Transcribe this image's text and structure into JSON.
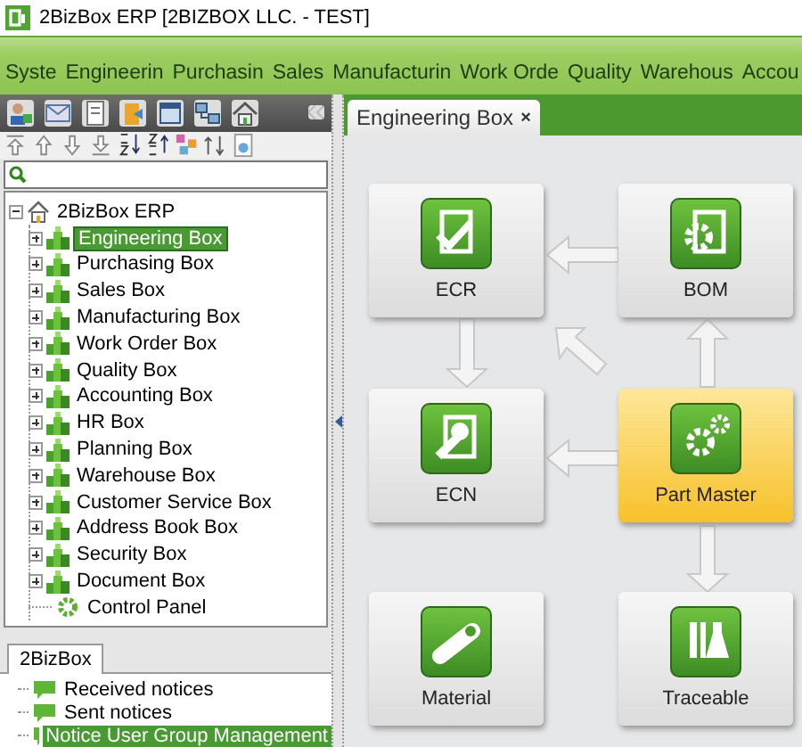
{
  "window": {
    "title": "2BizBox ERP [2BIZBOX LLC. - TEST]"
  },
  "menu": [
    "Syste",
    "Engineerin",
    "Purchasin",
    "Sales",
    "Manufacturin",
    "Work Orde",
    "Quality",
    "Warehous",
    "Accou"
  ],
  "sidebar": {
    "tree": {
      "label": "2BizBox ERP",
      "kind": "root",
      "expanded": true,
      "selected": false,
      "children": [
        {
          "label": "Engineering Box",
          "kind": "box",
          "expanded": false,
          "selected": true
        },
        {
          "label": "Purchasing Box",
          "kind": "box",
          "expanded": false,
          "selected": false
        },
        {
          "label": "Sales Box",
          "kind": "box",
          "expanded": false,
          "selected": false
        },
        {
          "label": "Manufacturing Box",
          "kind": "box",
          "expanded": false,
          "selected": false
        },
        {
          "label": "Work Order Box",
          "kind": "box",
          "expanded": false,
          "selected": false
        },
        {
          "label": "Quality Box",
          "kind": "box",
          "expanded": false,
          "selected": false
        },
        {
          "label": "Accounting Box",
          "kind": "box",
          "expanded": false,
          "selected": false
        },
        {
          "label": "HR Box",
          "kind": "box",
          "expanded": false,
          "selected": false
        },
        {
          "label": "Planning Box",
          "kind": "box",
          "expanded": false,
          "selected": false
        },
        {
          "label": "Warehouse Box",
          "kind": "box",
          "expanded": false,
          "selected": false
        },
        {
          "label": "Customer Service Box",
          "kind": "box",
          "expanded": false,
          "selected": false
        },
        {
          "label": "Address Book Box",
          "kind": "box",
          "expanded": false,
          "selected": false
        },
        {
          "label": "Security Box",
          "kind": "box",
          "expanded": false,
          "selected": false
        },
        {
          "label": "Document Box",
          "kind": "box",
          "expanded": false,
          "selected": false
        },
        {
          "label": "Control Panel",
          "kind": "panel",
          "selected": false
        }
      ]
    },
    "tabs": [
      {
        "label": "2BizBox",
        "selected": true
      }
    ],
    "notices": [
      {
        "label": "Received notices",
        "selected": false
      },
      {
        "label": "Sent notices",
        "selected": false
      },
      {
        "label": "Notice User Group Management",
        "selected": true
      }
    ]
  },
  "main": {
    "tabs": [
      {
        "label": "Engineering Box",
        "close": "×",
        "selected": true
      }
    ],
    "tiles": [
      {
        "label": "ECR",
        "kind": "check",
        "highlighted": false
      },
      {
        "label": "BOM",
        "kind": "gear-doc",
        "highlighted": false
      },
      {
        "label": "ECN",
        "kind": "wrench",
        "highlighted": false
      },
      {
        "label": "Part Master",
        "kind": "gears",
        "highlighted": true
      },
      {
        "label": "Material",
        "kind": "pipe",
        "highlighted": false
      },
      {
        "label": "Traceable",
        "kind": "flask",
        "highlighted": false
      }
    ]
  }
}
